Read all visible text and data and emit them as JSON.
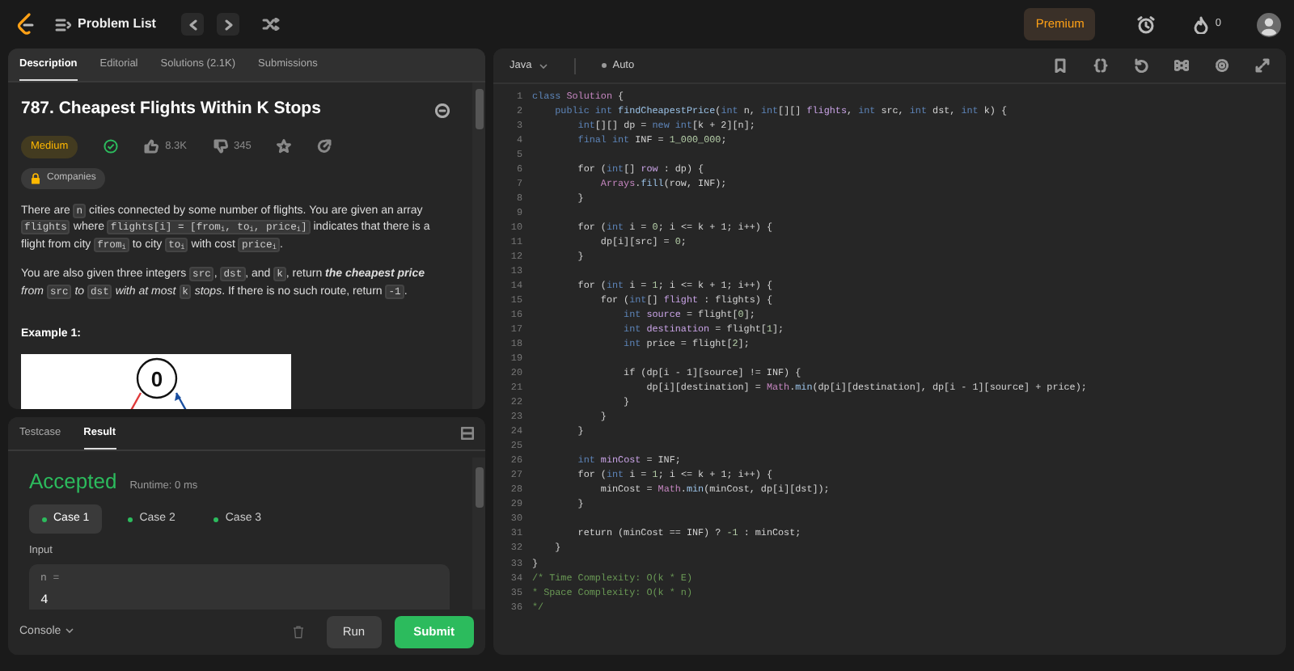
{
  "top_bar": {
    "title": "Problem List",
    "premium": "Premium",
    "streak": "0"
  },
  "description_panel": {
    "tabs": [
      {
        "label": "Description",
        "selected": true
      },
      {
        "label": "Editorial",
        "selected": false
      },
      {
        "label": "Solutions (2.1K)",
        "selected": false
      },
      {
        "label": "Submissions",
        "selected": false
      }
    ],
    "title": "787. Cheapest Flights Within K Stops",
    "difficulty": "Medium",
    "solved": true,
    "likes": "8.3K",
    "dislikes": "345",
    "companies": "Companies",
    "paragraphs": [
      [
        {
          "kind": "text",
          "text": "There are "
        },
        {
          "kind": "code",
          "text": "n"
        },
        {
          "kind": "text",
          "text": " cities connected by some number of flights. You are given an array "
        },
        {
          "kind": "code",
          "text": "flights"
        },
        {
          "kind": "text",
          "text": " where "
        },
        {
          "kind": "code",
          "text": "flights[i] = [from$_{i}$, to$_{i}$, price$_{i}$]"
        },
        {
          "kind": "text",
          "text": " indicates that there is a flight from city "
        },
        {
          "kind": "code",
          "text": "from$_{i}$"
        },
        {
          "kind": "text",
          "text": " to city "
        },
        {
          "kind": "code",
          "text": "to$_{i}$"
        },
        {
          "kind": "text",
          "text": " with cost "
        },
        {
          "kind": "code",
          "text": "price$_{i}$"
        },
        {
          "kind": "text",
          "text": "."
        }
      ],
      [
        {
          "kind": "text",
          "text": "You are also given three integers "
        },
        {
          "kind": "code",
          "text": "src"
        },
        {
          "kind": "text",
          "text": ", "
        },
        {
          "kind": "code",
          "text": "dst"
        },
        {
          "kind": "text",
          "text": ", and "
        },
        {
          "kind": "code",
          "text": "k"
        },
        {
          "kind": "text",
          "text": ", return "
        },
        {
          "kind": "strong",
          "text": "the cheapest price"
        },
        {
          "kind": "em",
          "text": " from "
        },
        {
          "kind": "code",
          "text": "src"
        },
        {
          "kind": "em",
          "text": " to "
        },
        {
          "kind": "code",
          "text": "dst"
        },
        {
          "kind": "em",
          "text": " with at most "
        },
        {
          "kind": "code",
          "text": "k"
        },
        {
          "kind": "em",
          "text": " stops"
        },
        {
          "kind": "text",
          "text": ". If there is no such route, return "
        },
        {
          "kind": "code",
          "text": "-1"
        },
        {
          "kind": "text",
          "text": "."
        }
      ]
    ],
    "example_heading": "Example 1:",
    "example_node": "0"
  },
  "result_panel": {
    "tabs": [
      {
        "label": "Testcase",
        "selected": false
      },
      {
        "label": "Result",
        "selected": true
      }
    ],
    "verdict": "Accepted",
    "runtime": "Runtime: 0 ms",
    "cases": [
      {
        "label": "Case 1",
        "selected": true,
        "passed": true
      },
      {
        "label": "Case 2",
        "selected": false,
        "passed": true
      },
      {
        "label": "Case 3",
        "selected": false,
        "passed": true
      }
    ],
    "input_label": "Input",
    "input_name": "n =",
    "input_value": "4",
    "console": "Console",
    "run": "Run",
    "submit": "Submit"
  },
  "editor": {
    "language": "Java",
    "mode": "Auto",
    "lines": [
      {
        "n": "1",
        "tokens": [
          {
            "kind": "kw",
            "text": "class "
          },
          {
            "kind": "cls",
            "text": "Solution"
          },
          {
            "kind": "p",
            "text": " {"
          }
        ]
      },
      {
        "n": "2",
        "tokens": [
          {
            "kind": "kw",
            "text": "    public int "
          },
          {
            "kind": "fn",
            "text": "findCheapestPrice"
          },
          {
            "kind": "p",
            "text": "("
          },
          {
            "kind": "kw",
            "text": "int"
          },
          {
            "kind": "p",
            "text": " n, "
          },
          {
            "kind": "kw",
            "text": "int"
          },
          {
            "kind": "p",
            "text": "[][] "
          },
          {
            "kind": "var",
            "text": "flights"
          },
          {
            "kind": "p",
            "text": ", "
          },
          {
            "kind": "kw",
            "text": "int"
          },
          {
            "kind": "p",
            "text": " src, "
          },
          {
            "kind": "kw",
            "text": "int"
          },
          {
            "kind": "p",
            "text": " dst, "
          },
          {
            "kind": "kw",
            "text": "int"
          },
          {
            "kind": "p",
            "text": " k) {"
          }
        ]
      },
      {
        "n": "3",
        "tokens": [
          {
            "kind": "kw",
            "text": "        int"
          },
          {
            "kind": "p",
            "text": "[][] dp = "
          },
          {
            "kind": "kw",
            "text": "new int"
          },
          {
            "kind": "p",
            "text": "[k + 2][n];"
          }
        ]
      },
      {
        "n": "4",
        "tokens": [
          {
            "kind": "kw",
            "text": "        final int"
          },
          {
            "kind": "p",
            "text": " INF = "
          },
          {
            "kind": "num",
            "text": "1_000_000"
          },
          {
            "kind": "p",
            "text": ";"
          }
        ]
      },
      {
        "n": "5"
      },
      {
        "n": "6",
        "tokens": [
          {
            "kind": "p",
            "text": "        for ("
          },
          {
            "kind": "kw",
            "text": "int"
          },
          {
            "kind": "p",
            "text": "[] "
          },
          {
            "kind": "var",
            "text": "row"
          },
          {
            "kind": "p",
            "text": " : dp) {"
          }
        ]
      },
      {
        "n": "7",
        "tokens": [
          {
            "kind": "cls",
            "text": "            Arrays"
          },
          {
            "kind": "p",
            "text": "."
          },
          {
            "kind": "fn",
            "text": "fill"
          },
          {
            "kind": "p",
            "text": "(row, INF);"
          }
        ]
      },
      {
        "n": "8",
        "tokens": [
          {
            "kind": "p",
            "text": "        }"
          }
        ]
      },
      {
        "n": "9"
      },
      {
        "n": "10",
        "tokens": [
          {
            "kind": "p",
            "text": "        for ("
          },
          {
            "kind": "kw",
            "text": "int"
          },
          {
            "kind": "p",
            "text": " i = "
          },
          {
            "kind": "num",
            "text": "0"
          },
          {
            "kind": "p",
            "text": "; i <= k + 1; i++) {"
          }
        ]
      },
      {
        "n": "11",
        "tokens": [
          {
            "kind": "p",
            "text": "            dp[i][src] = "
          },
          {
            "kind": "num",
            "text": "0"
          },
          {
            "kind": "p",
            "text": ";"
          }
        ]
      },
      {
        "n": "12",
        "tokens": [
          {
            "kind": "p",
            "text": "        }"
          }
        ]
      },
      {
        "n": "13"
      },
      {
        "n": "14",
        "tokens": [
          {
            "kind": "p",
            "text": "        for ("
          },
          {
            "kind": "kw",
            "text": "int"
          },
          {
            "kind": "p",
            "text": " i = "
          },
          {
            "kind": "num",
            "text": "1"
          },
          {
            "kind": "p",
            "text": "; i <= k + 1; i++) {"
          }
        ]
      },
      {
        "n": "15",
        "tokens": [
          {
            "kind": "p",
            "text": "            for ("
          },
          {
            "kind": "kw",
            "text": "int"
          },
          {
            "kind": "p",
            "text": "[] "
          },
          {
            "kind": "var",
            "text": "flight"
          },
          {
            "kind": "p",
            "text": " : flights) {"
          }
        ]
      },
      {
        "n": "16",
        "tokens": [
          {
            "kind": "kw",
            "text": "                int"
          },
          {
            "kind": "var",
            "text": " source"
          },
          {
            "kind": "p",
            "text": " = flight["
          },
          {
            "kind": "num",
            "text": "0"
          },
          {
            "kind": "p",
            "text": "];"
          }
        ]
      },
      {
        "n": "17",
        "tokens": [
          {
            "kind": "kw",
            "text": "                int"
          },
          {
            "kind": "var",
            "text": " destination"
          },
          {
            "kind": "p",
            "text": " = flight["
          },
          {
            "kind": "num",
            "text": "1"
          },
          {
            "kind": "p",
            "text": "];"
          }
        ]
      },
      {
        "n": "18",
        "tokens": [
          {
            "kind": "kw",
            "text": "                int"
          },
          {
            "kind": "p",
            "text": " price = flight["
          },
          {
            "kind": "num",
            "text": "2"
          },
          {
            "kind": "p",
            "text": "];"
          }
        ]
      },
      {
        "n": "19"
      },
      {
        "n": "20",
        "tokens": [
          {
            "kind": "p",
            "text": "                if (dp[i - 1][source] != INF) {"
          }
        ]
      },
      {
        "n": "21",
        "tokens": [
          {
            "kind": "p",
            "text": "                    dp[i][destination] = "
          },
          {
            "kind": "cls",
            "text": "Math"
          },
          {
            "kind": "p",
            "text": "."
          },
          {
            "kind": "fn",
            "text": "min"
          },
          {
            "kind": "p",
            "text": "(dp[i][destination], dp[i - 1][source] + price);"
          }
        ]
      },
      {
        "n": "22",
        "tokens": [
          {
            "kind": "p",
            "text": "                }"
          }
        ]
      },
      {
        "n": "23",
        "tokens": [
          {
            "kind": "p",
            "text": "            }"
          }
        ]
      },
      {
        "n": "24",
        "tokens": [
          {
            "kind": "p",
            "text": "        }"
          }
        ]
      },
      {
        "n": "25"
      },
      {
        "n": "26",
        "tokens": [
          {
            "kind": "kw",
            "text": "        int"
          },
          {
            "kind": "var",
            "text": " minCost"
          },
          {
            "kind": "p",
            "text": " = INF;"
          }
        ]
      },
      {
        "n": "27",
        "tokens": [
          {
            "kind": "p",
            "text": "        for ("
          },
          {
            "kind": "kw",
            "text": "int"
          },
          {
            "kind": "p",
            "text": " i = "
          },
          {
            "kind": "num",
            "text": "1"
          },
          {
            "kind": "p",
            "text": "; i <= k + 1; i++) {"
          }
        ]
      },
      {
        "n": "28",
        "tokens": [
          {
            "kind": "p",
            "text": "            minCost = "
          },
          {
            "kind": "cls",
            "text": "Math"
          },
          {
            "kind": "p",
            "text": "."
          },
          {
            "kind": "fn",
            "text": "min"
          },
          {
            "kind": "p",
            "text": "(minCost, dp[i][dst]);"
          }
        ]
      },
      {
        "n": "29",
        "tokens": [
          {
            "kind": "p",
            "text": "        }"
          }
        ]
      },
      {
        "n": "30"
      },
      {
        "n": "31",
        "tokens": [
          {
            "kind": "p",
            "text": "        return (minCost == INF) ? "
          },
          {
            "kind": "num",
            "text": "-1"
          },
          {
            "kind": "p",
            "text": " : minCost;"
          }
        ]
      },
      {
        "n": "32",
        "tokens": [
          {
            "kind": "p",
            "text": "    }"
          }
        ]
      },
      {
        "n": "33",
        "tokens": [
          {
            "kind": "p",
            "text": "}"
          }
        ]
      },
      {
        "n": "34",
        "tokens": [
          {
            "kind": "cm",
            "text": "/* Time Complexity: O(k * E)"
          }
        ]
      },
      {
        "n": "35",
        "tokens": [
          {
            "kind": "cm",
            "text": "* Space Complexity: O(k * n)"
          }
        ]
      },
      {
        "n": "36",
        "tokens": [
          {
            "kind": "cm",
            "text": "*/"
          }
        ]
      }
    ]
  }
}
